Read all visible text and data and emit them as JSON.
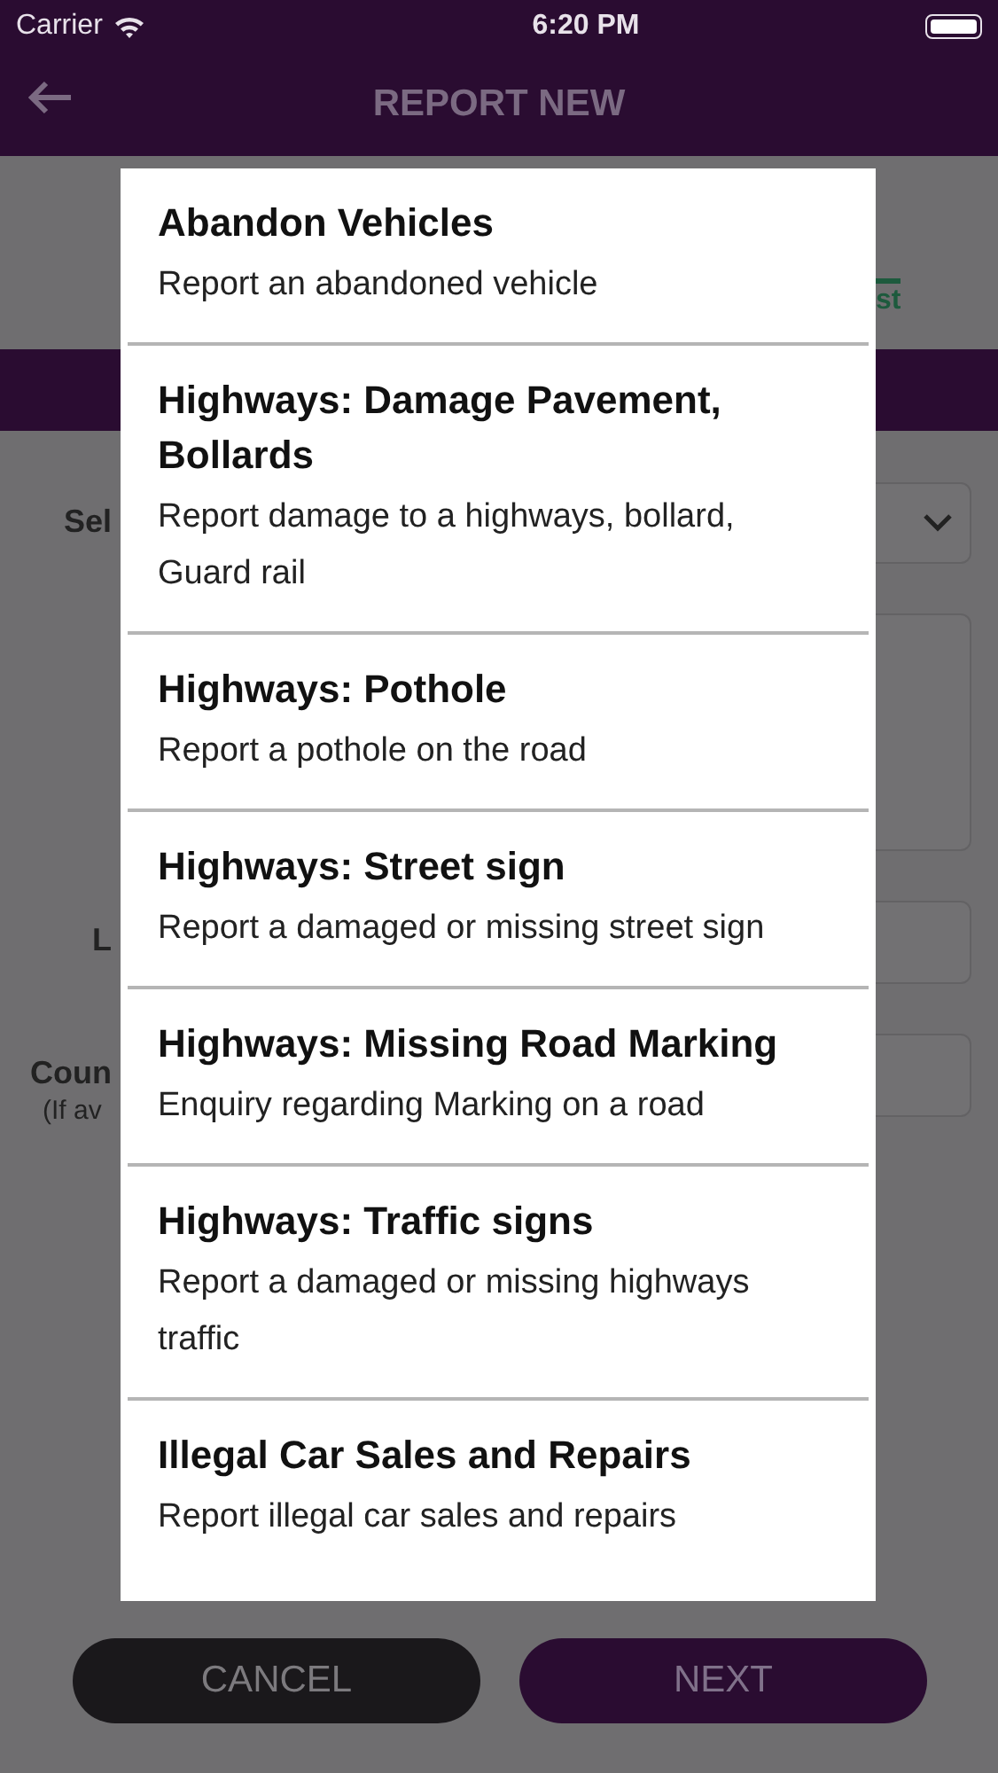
{
  "status_bar": {
    "carrier": "Carrier",
    "time": "6:20 PM"
  },
  "nav": {
    "title": "REPORT NEW"
  },
  "background_form": {
    "tab_fragment": "st",
    "fields": [
      {
        "kind": "select",
        "label": "Sel"
      },
      {
        "kind": "textarea"
      },
      {
        "kind": "input",
        "label": "L"
      },
      {
        "kind": "input",
        "label": "Coun",
        "hint": "(If av"
      }
    ]
  },
  "modal": {
    "items": [
      {
        "title": "Abandon Vehicles",
        "description": "Report an abandoned vehicle"
      },
      {
        "title": "Highways: Damage Pavement, Bollards",
        "description": "Report damage to a highways, bollard, Guard rail"
      },
      {
        "title": "Highways: Pothole",
        "description": "Report a pothole on the road"
      },
      {
        "title": "Highways: Street sign",
        "description": "Report a damaged or missing street sign"
      },
      {
        "title": "Highways: Missing Road Marking",
        "description": "Enquiry regarding Marking on a road"
      },
      {
        "title": "Highways: Traffic signs",
        "description": "Report a damaged or missing highways traffic"
      },
      {
        "title": "Illegal Car Sales and Repairs",
        "description": "Report illegal car sales and repairs"
      }
    ]
  },
  "buttons": [
    {
      "label": "CANCEL",
      "kind": "secondary"
    },
    {
      "label": "NEXT",
      "kind": "primary"
    }
  ]
}
